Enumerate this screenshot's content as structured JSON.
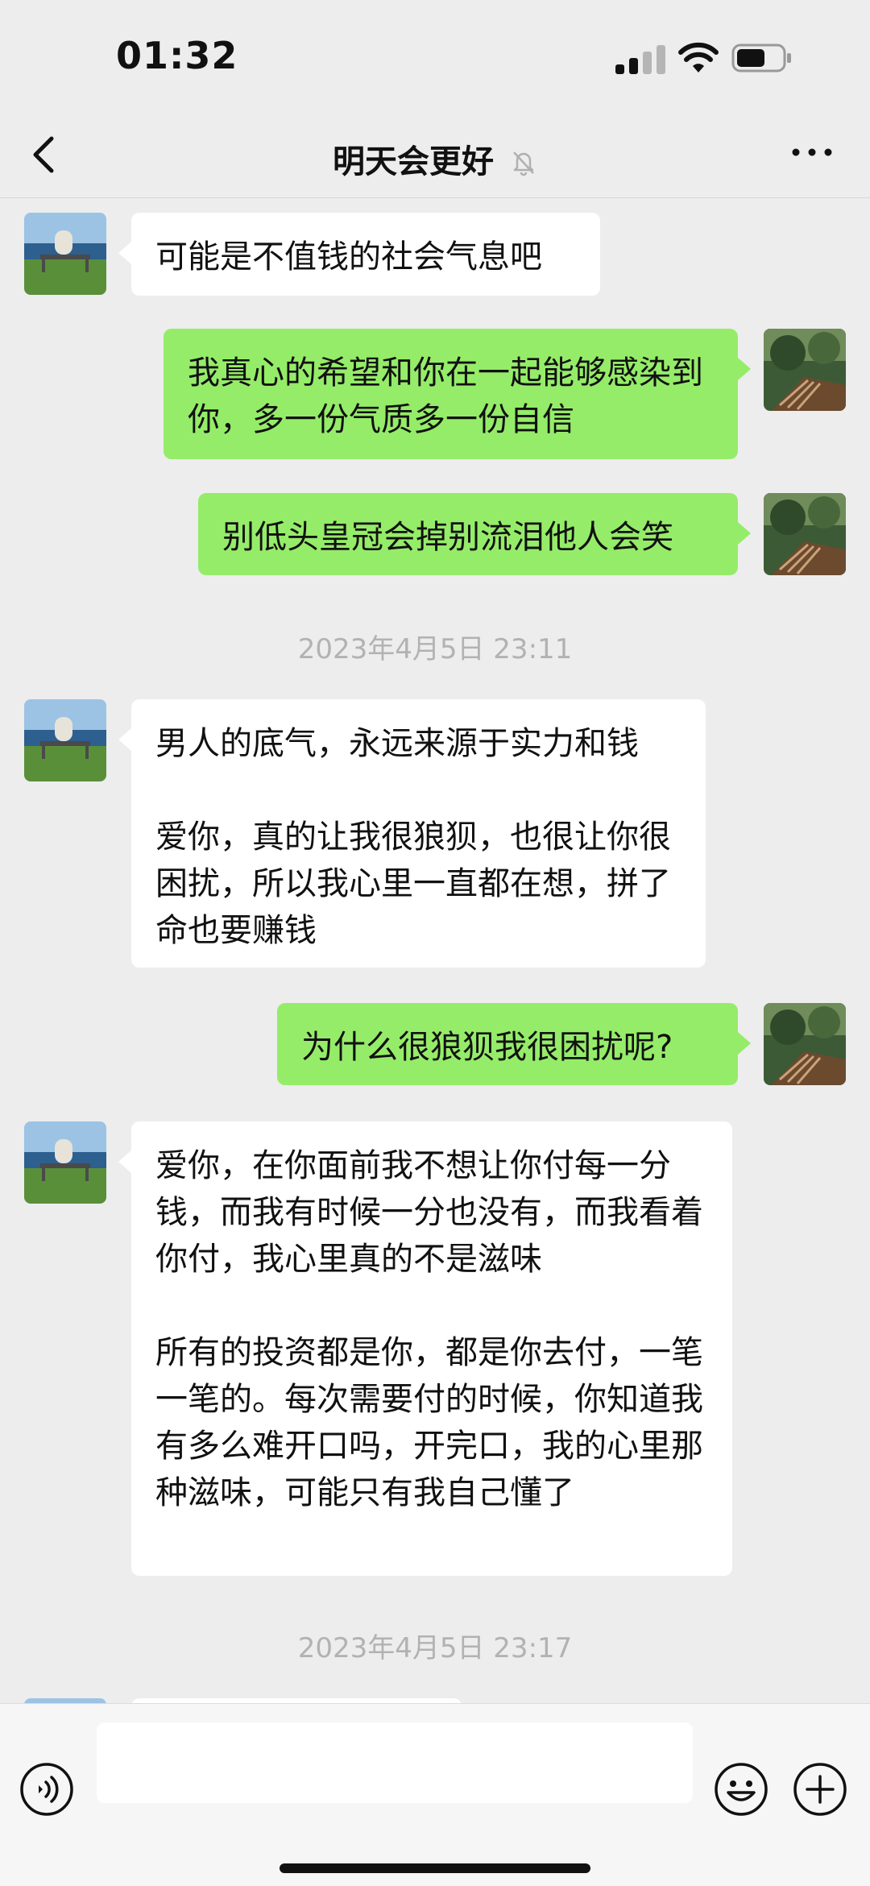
{
  "status_bar": {
    "time": "01:32"
  },
  "nav": {
    "title": "明天会更好",
    "icons": [
      "back-icon",
      "mute-bell-icon",
      "more-icon"
    ]
  },
  "messages": [
    {
      "side": "in",
      "text": "可能是不值钱的社会气息吧"
    },
    {
      "side": "out",
      "text": "我真心的希望和你在一起能够感染到你，多一份气质多一份自信"
    },
    {
      "side": "out",
      "text": "别低头皇冠会掉别流泪他人会笑"
    },
    {
      "timestamp": "2023年4月5日 23:11"
    },
    {
      "side": "in",
      "text": "男人的底气，永远来源于实力和钱\n\n爱你，真的让我很狼狈，也很让你很困扰，所以我心里一直都在想，拼了命也要赚钱"
    },
    {
      "side": "out",
      "text": "为什么很狼狈我很困扰呢?"
    },
    {
      "side": "in",
      "text": "爱你，在你面前我不想让你付每一分钱，而我有时候一分也没有，而我看着你付，我心里真的不是滋味\n\n所有的投资都是你，都是你去付，一笔一笔的。每次需要付的时候，你知道我有多么难开口吗，开完口，我的心里那种滋味，可能只有我自己懂了"
    },
    {
      "timestamp": "2023年4月5日 23:17"
    }
  ],
  "input_bar": {
    "placeholder": "",
    "icons": [
      "voice-icon",
      "emoji-icon",
      "plus-icon"
    ]
  },
  "colors": {
    "background": "#ededed",
    "incoming_bubble": "#ffffff",
    "outgoing_bubble": "#95ec69",
    "timestamp_text": "#b2b2b2"
  }
}
